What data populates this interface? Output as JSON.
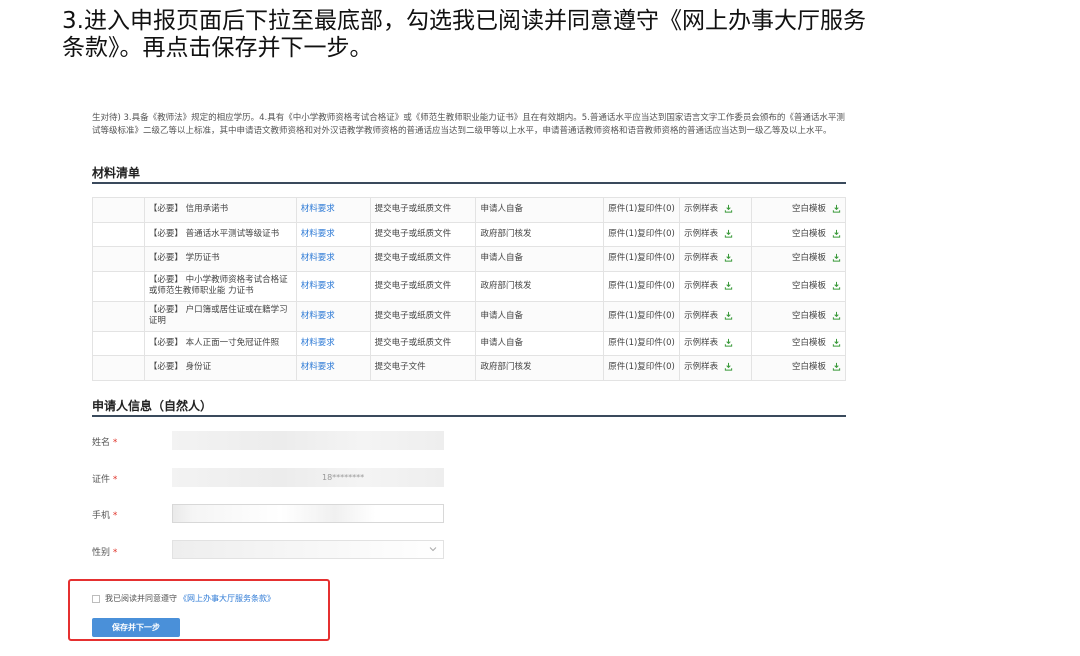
{
  "instruction": {
    "line1": "3.进入申报页面后下拉至最底部，勾选我已阅读并同意遵守《网上办事大厅服务",
    "line2": "条款》。再点击保存并下一步。"
  },
  "intro": {
    "text": "生对待) 3.具备《教师法》规定的相应学历。4.具有《中小学教师资格考试合格证》或《师范生教师职业能力证书》且在有效期内。5.普通话水平应当达到国家语言文字工作委员会颁布的《普通话水平测试等级标准》二级乙等以上标准，其中申请语文教师资格和对外汉语教学教师资格的普通话应当达到二级甲等以上水平，申请普通话教师资格和语音教师资格的普通话应当达到一级乙等及以上水平。"
  },
  "materials": {
    "title": "材料清单",
    "rows": [
      {
        "name": "【必要】 信用承诺书",
        "req": "材料要求",
        "submit": "提交电子或纸质文件",
        "source": "申请人自备",
        "count": "原件(1)复印件(0)",
        "sample": "示例样表",
        "blank": "空白模板"
      },
      {
        "name": "【必要】 普通话水平测试等级证书",
        "req": "材料要求",
        "submit": "提交电子或纸质文件",
        "source": "政府部门核发",
        "count": "原件(1)复印件(0)",
        "sample": "示例样表",
        "blank": "空白模板"
      },
      {
        "name": "【必要】 学历证书",
        "req": "材料要求",
        "submit": "提交电子或纸质文件",
        "source": "申请人自备",
        "count": "原件(1)复印件(0)",
        "sample": "示例样表",
        "blank": "空白模板"
      },
      {
        "name": "【必要】 中小学教师资格考试合格证或师范生教师职业能 力证书",
        "req": "材料要求",
        "submit": "提交电子或纸质文件",
        "source": "政府部门核发",
        "count": "原件(1)复印件(0)",
        "sample": "示例样表",
        "blank": "空白模板"
      },
      {
        "name": "【必要】 户口簿或居住证或在籍学习证明",
        "req": "材料要求",
        "submit": "提交电子或纸质文件",
        "source": "申请人自备",
        "count": "原件(1)复印件(0)",
        "sample": "示例样表",
        "blank": "空白模板"
      },
      {
        "name": "【必要】 本人正面一寸免冠证件照",
        "req": "材料要求",
        "submit": "提交电子或纸质文件",
        "source": "申请人自备",
        "count": "原件(1)复印件(0)",
        "sample": "示例样表",
        "blank": "空白模板"
      },
      {
        "name": "【必要】 身份证",
        "req": "材料要求",
        "submit": "提交电子文件",
        "source": "政府部门核发",
        "count": "原件(1)复印件(0)",
        "sample": "示例样表",
        "blank": "空白模板"
      }
    ]
  },
  "applicant": {
    "title": "申请人信息（自然人）",
    "fields": [
      {
        "label": "姓名",
        "value": ""
      },
      {
        "label": "证件",
        "value": "18********"
      },
      {
        "label": "手机",
        "value": ""
      },
      {
        "label": "性别",
        "value": ""
      }
    ],
    "required_mark": "*"
  },
  "agreement": {
    "text": "我已阅读并同意遵守",
    "link": "《网上办事大厅服务条款》"
  },
  "save_button": "保存并下一步",
  "colors": {
    "link": "#2f7bd6",
    "button": "#4a90d9",
    "highlight": "#e53030",
    "required": "#e0352b"
  }
}
